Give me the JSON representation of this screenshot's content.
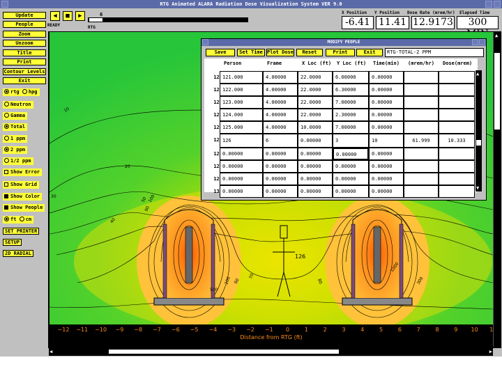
{
  "title_bar": {
    "text": "RTG Animated ALARA Radiation Dose Visualization System VER 9.0"
  },
  "left_panel": {
    "buttons": [
      "Update",
      "People",
      "Zoom",
      "Unzoom",
      "Title",
      "Print",
      "Contour Levels",
      "Exit"
    ],
    "source": [
      {
        "label": "rtg",
        "selected": true
      },
      {
        "label": "hpg",
        "selected": false
      }
    ],
    "radiation_types": [
      {
        "label": "Neutron",
        "selected": false
      },
      {
        "label": "Gamma",
        "selected": false
      },
      {
        "label": "Total",
        "selected": true
      }
    ],
    "people_count": [
      {
        "label": "1 ppm",
        "selected": false
      },
      {
        "label": "2 ppm",
        "selected": true
      },
      {
        "label": "1/2 ppm",
        "selected": false
      }
    ],
    "toggles": [
      {
        "label": "Show Error",
        "checked": false
      },
      {
        "label": "Show Grid",
        "checked": false
      },
      {
        "label": "Show Color",
        "checked": true
      },
      {
        "label": "Show People",
        "checked": true
      }
    ],
    "units": [
      {
        "label": "ft",
        "selected": true
      },
      {
        "label": "cm",
        "selected": false
      }
    ],
    "extra_buttons": [
      "SET PRINTER",
      "SETUP",
      "2D RADIAL"
    ]
  },
  "toolbar": {
    "frame_number": "6",
    "status": "READY",
    "source_label": "RTG",
    "prev_icon": "◀",
    "stop_icon": "■",
    "next_icon": "▶",
    "progress": 0.09
  },
  "readouts": {
    "labels": [
      "X Position",
      "Y Position",
      "Dose Rate (mrem/hr)",
      "Elapsed Time"
    ],
    "values": [
      "-6.41",
      "11.41",
      "12.9173",
      "300 MIN"
    ]
  },
  "plot": {
    "xlabel": "Distance from RTG (ft)",
    "xticks": [
      "−12",
      "−11",
      "−10",
      "−9",
      "−8",
      "−7",
      "−6",
      "−5",
      "−4",
      "−3",
      "−2",
      "−1",
      "0",
      "1",
      "2",
      "3",
      "4",
      "5",
      "6",
      "7",
      "8",
      "9",
      "10",
      "11"
    ],
    "contour_labels": [
      "10",
      "20",
      "30",
      "40",
      "50",
      "60",
      "70",
      "80",
      "90",
      "100",
      "200",
      "300",
      "500",
      "1000"
    ],
    "person_label": "126",
    "colors": {
      "background": "#33cc33",
      "hot": "#ff9933",
      "core": "#ff6600"
    }
  },
  "dialog": {
    "title": "MODIFY PEOPLE",
    "buttons": [
      "Save",
      "Set Time",
      "Plot Dose",
      "Reset",
      "Print",
      "Exit"
    ],
    "filename": "RTG-TOTAL-2 PPM",
    "columns": [
      "Person",
      "Frame",
      "X Loc (ft)",
      "Y Loc (ft)",
      "Time(min)",
      "(mrem/hr)",
      "Dose(mrem)"
    ],
    "rows": [
      {
        "num": "121",
        "cells": [
          "121.000",
          "4.00000",
          "22.0000",
          "6.00000",
          "0.00000",
          "",
          ""
        ]
      },
      {
        "num": "122",
        "cells": [
          "122.000",
          "4.00000",
          "22.0000",
          "6.30000",
          "0.00000",
          "",
          ""
        ]
      },
      {
        "num": "123",
        "cells": [
          "123.000",
          "4.00000",
          "22.0000",
          "7.00000",
          "0.00000",
          "",
          ""
        ]
      },
      {
        "num": "124",
        "cells": [
          "124.000",
          "4.00000",
          "22.0000",
          "2.30000",
          "0.00000",
          "",
          ""
        ]
      },
      {
        "num": "125",
        "cells": [
          "125.000",
          "4.00000",
          "10.0000",
          "7.00000",
          "0.00000",
          "",
          ""
        ]
      },
      {
        "num": "126",
        "cells": [
          "126",
          "6",
          "0.00000",
          "3",
          "10",
          "61.999",
          "10.333"
        ]
      },
      {
        "num": "127",
        "cells": [
          "0.00000",
          "0.00000",
          "0.00000",
          "0.00000",
          "0.00000",
          "",
          ""
        ]
      },
      {
        "num": "128",
        "cells": [
          "0.00000",
          "0.00000",
          "0.00000",
          "0.00000",
          "0.00000",
          "",
          ""
        ]
      },
      {
        "num": "129",
        "cells": [
          "0.00000",
          "0.00000",
          "0.00000",
          "0.00000",
          "0.00000",
          "",
          ""
        ]
      },
      {
        "num": "130",
        "cells": [
          "0.00000",
          "0.00000",
          "0.00000",
          "0.00000",
          "0.00000",
          "",
          ""
        ]
      }
    ]
  }
}
